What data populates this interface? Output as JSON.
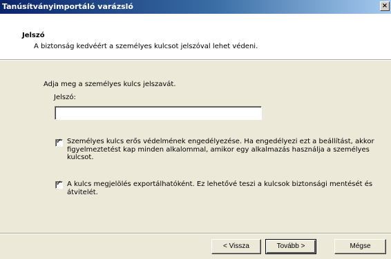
{
  "window": {
    "title": "Tanúsítványimportáló varázsló",
    "close_label": "×"
  },
  "header": {
    "title": "Jelszó",
    "subtitle": "A biztonság kedvéért a személyes kulcsot jelszóval lehet védeni."
  },
  "content": {
    "intro": "Adja meg a személyes kulcs jelszavát.",
    "password": {
      "label": "Jelszó:",
      "value": "",
      "placeholder": ""
    },
    "options": [
      {
        "checked": true,
        "label": "Személyes kulcs erős védelmének engedélyezése. Ha engedélyezi ezt a beállítást, akkor figyelmeztetést kap minden alkalommal, amikor egy alkalmazás használja a személyes kulcsot."
      },
      {
        "checked": true,
        "label": "A kulcs megjelölés exportálhatóként. Ez lehetővé teszi a kulcsok biztonsági mentését és átvitelét."
      }
    ],
    "check_mark": "✓"
  },
  "footer": {
    "back_label": "< Vissza",
    "next_label": "Tovább >",
    "cancel_label": "Mégse"
  }
}
